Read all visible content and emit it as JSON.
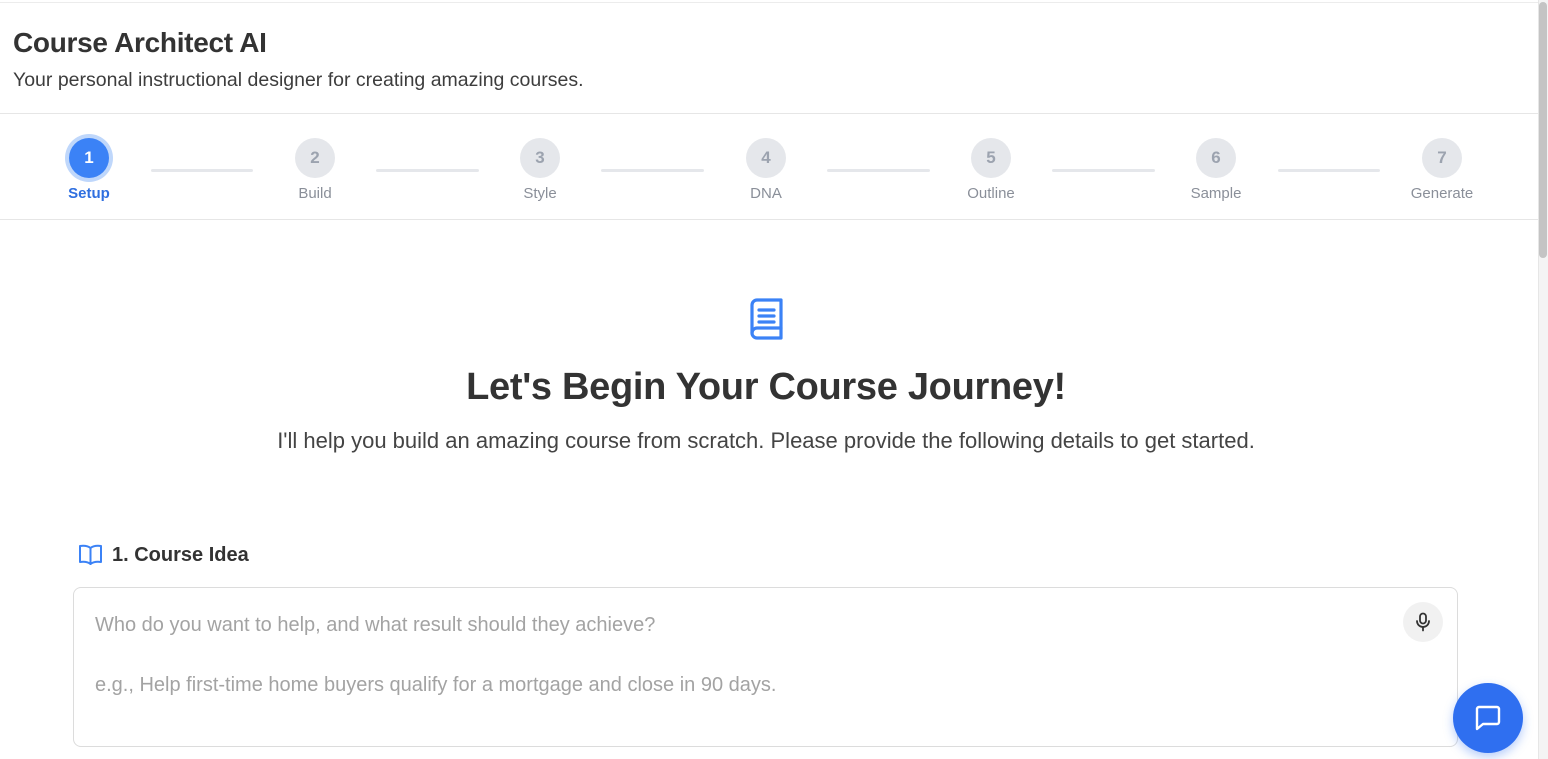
{
  "header": {
    "title": "Course Architect AI",
    "subtitle": "Your personal instructional designer for creating amazing courses."
  },
  "stepper": {
    "active_step": 1,
    "steps": [
      {
        "number": "1",
        "label": "Setup"
      },
      {
        "number": "2",
        "label": "Build"
      },
      {
        "number": "3",
        "label": "Style"
      },
      {
        "number": "4",
        "label": "DNA"
      },
      {
        "number": "5",
        "label": "Outline"
      },
      {
        "number": "6",
        "label": "Sample"
      },
      {
        "number": "7",
        "label": "Generate"
      }
    ]
  },
  "hero": {
    "icon": "book-icon",
    "title": "Let's Begin Your Course Journey!",
    "text": "I'll help you build an amazing course from scratch. Please provide the following details to get started."
  },
  "course_idea": {
    "icon": "open-book-icon",
    "label": "1. Course Idea",
    "value": "",
    "placeholder": "Who do you want to help, and what result should they achieve?\n\ne.g., Help first-time home buyers qualify for a mortgage and close in 90 days."
  },
  "icons": {
    "mic": "microphone-icon",
    "chat": "chat-icon"
  },
  "colors": {
    "accent": "#3b82f6",
    "fab": "#2f6ff0",
    "inactive_step": "#e5e7eb"
  }
}
